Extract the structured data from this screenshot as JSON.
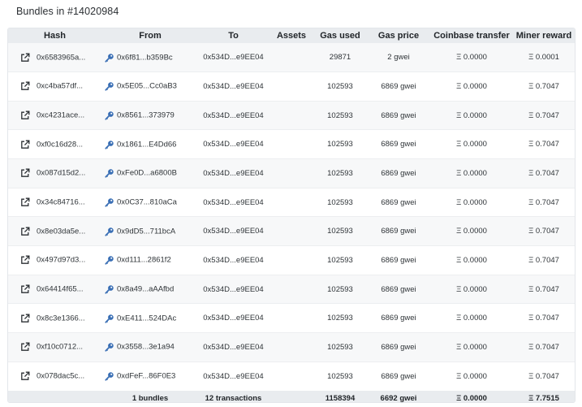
{
  "page": {
    "title": "Bundles in #14020984"
  },
  "table": {
    "columns": [
      "Hash",
      "From",
      "To",
      "Assets",
      "Gas used",
      "Gas price",
      "Coinbase transfer",
      "Miner reward"
    ],
    "rows": [
      {
        "hash": "0x6583965a...",
        "from": "0x6f81...b359Bc",
        "to": "0x534D...e9EE04",
        "assets": "",
        "gas_used": "29871",
        "gas_price": "2 gwei",
        "coinbase_transfer": "Ξ 0.0000",
        "miner_reward": "Ξ 0.0001"
      },
      {
        "hash": "0xc4ba57df...",
        "from": "0x5E05...Cc0aB3",
        "to": "0x534D...e9EE04",
        "assets": "",
        "gas_used": "102593",
        "gas_price": "6869 gwei",
        "coinbase_transfer": "Ξ 0.0000",
        "miner_reward": "Ξ 0.7047"
      },
      {
        "hash": "0xc4231ace...",
        "from": "0x8561...373979",
        "to": "0x534D...e9EE04",
        "assets": "",
        "gas_used": "102593",
        "gas_price": "6869 gwei",
        "coinbase_transfer": "Ξ 0.0000",
        "miner_reward": "Ξ 0.7047"
      },
      {
        "hash": "0xf0c16d28...",
        "from": "0x1861...E4Dd66",
        "to": "0x534D...e9EE04",
        "assets": "",
        "gas_used": "102593",
        "gas_price": "6869 gwei",
        "coinbase_transfer": "Ξ 0.0000",
        "miner_reward": "Ξ 0.7047"
      },
      {
        "hash": "0x087d15d2...",
        "from": "0xFe0D...a6800B",
        "to": "0x534D...e9EE04",
        "assets": "",
        "gas_used": "102593",
        "gas_price": "6869 gwei",
        "coinbase_transfer": "Ξ 0.0000",
        "miner_reward": "Ξ 0.7047"
      },
      {
        "hash": "0x34c84716...",
        "from": "0x0C37...810aCa",
        "to": "0x534D...e9EE04",
        "assets": "",
        "gas_used": "102593",
        "gas_price": "6869 gwei",
        "coinbase_transfer": "Ξ 0.0000",
        "miner_reward": "Ξ 0.7047"
      },
      {
        "hash": "0x8e03da5e...",
        "from": "0x9dD5...711bcA",
        "to": "0x534D...e9EE04",
        "assets": "",
        "gas_used": "102593",
        "gas_price": "6869 gwei",
        "coinbase_transfer": "Ξ 0.0000",
        "miner_reward": "Ξ 0.7047"
      },
      {
        "hash": "0x497d97d3...",
        "from": "0xd111...2861f2",
        "to": "0x534D...e9EE04",
        "assets": "",
        "gas_used": "102593",
        "gas_price": "6869 gwei",
        "coinbase_transfer": "Ξ 0.0000",
        "miner_reward": "Ξ 0.7047"
      },
      {
        "hash": "0x64414f65...",
        "from": "0x8a49...aAAfbd",
        "to": "0x534D...e9EE04",
        "assets": "",
        "gas_used": "102593",
        "gas_price": "6869 gwei",
        "coinbase_transfer": "Ξ 0.0000",
        "miner_reward": "Ξ 0.7047"
      },
      {
        "hash": "0x8c3e1366...",
        "from": "0xE411...524DAc",
        "to": "0x534D...e9EE04",
        "assets": "",
        "gas_used": "102593",
        "gas_price": "6869 gwei",
        "coinbase_transfer": "Ξ 0.0000",
        "miner_reward": "Ξ 0.7047"
      },
      {
        "hash": "0xf10c0712...",
        "from": "0x3558...3e1a94",
        "to": "0x534D...e9EE04",
        "assets": "",
        "gas_used": "102593",
        "gas_price": "6869 gwei",
        "coinbase_transfer": "Ξ 0.0000",
        "miner_reward": "Ξ 0.7047"
      },
      {
        "hash": "0x078dac5c...",
        "from": "0xdFeF...86F0E3",
        "to": "0x534D...e9EE04",
        "assets": "",
        "gas_used": "102593",
        "gas_price": "6869 gwei",
        "coinbase_transfer": "Ξ 0.0000",
        "miner_reward": "Ξ 0.7047"
      }
    ],
    "totals": {
      "hash": "",
      "from": "1 bundles",
      "to": "12 transactions",
      "assets": "",
      "gas_used": "1158394",
      "gas_price": "6692 gwei",
      "coinbase_transfer": "Ξ 0.0000",
      "miner_reward": "Ξ 7.7515"
    }
  },
  "icons": {
    "hash_link": "external-link-icon",
    "from_address": "key-icon"
  },
  "colors": {
    "header_bg": "#e9ecef",
    "stripe_bg": "#f7f8f9",
    "text": "#212529"
  }
}
